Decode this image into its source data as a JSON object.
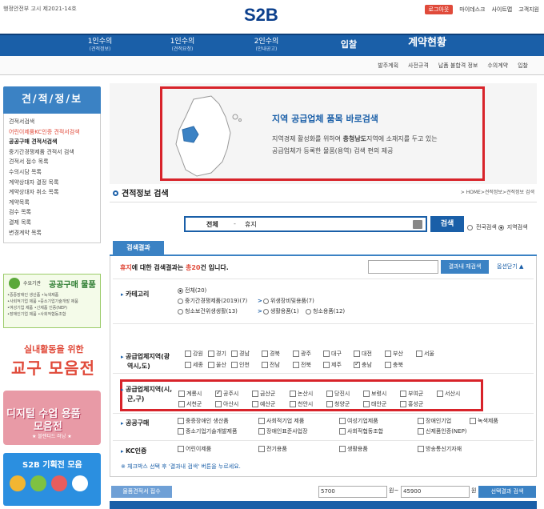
{
  "header": {
    "notice": "행정안전부 고시 제2021-14호",
    "logo": "S2B",
    "login": "로그아웃",
    "links": [
      "마이데스크",
      "사이트맵",
      "고객지원"
    ]
  },
  "nav": {
    "items": [
      {
        "label": "1인수의",
        "sub": "(견적정보)"
      },
      {
        "label": "1인수의",
        "sub": "(견적요청)"
      },
      {
        "label": "2인수의",
        "sub": "(안내공고)"
      }
    ],
    "bid": "입찰",
    "contract": "계약현황",
    "sub_links": [
      "발주계획",
      "사전규격",
      "납품 불합격 정보",
      "수의계약",
      "입찰"
    ]
  },
  "sidebar": {
    "title": "견/적/정/보",
    "items": [
      {
        "label": "견적서검색",
        "style": ""
      },
      {
        "label": "어린이제품KC인증 견적서검색",
        "style": "red"
      },
      {
        "label": "공공구매 견적서검색",
        "style": "bold"
      },
      {
        "label": "중기간경쟁제품 견적서 검색",
        "style": ""
      },
      {
        "label": "견적서 접수 목록",
        "style": ""
      },
      {
        "label": "수의시담 목록",
        "style": ""
      },
      {
        "label": "계약상대자 결정 목록",
        "style": ""
      },
      {
        "label": "계약상대자 취소 목록",
        "style": ""
      },
      {
        "label": "계약목록",
        "style": ""
      },
      {
        "label": "검수 목록",
        "style": ""
      },
      {
        "label": "결제 목록",
        "style": ""
      },
      {
        "label": "변경계약 목록",
        "style": ""
      }
    ],
    "banner1": {
      "small": "수요기관",
      "title": "공공구매 물품",
      "lines": [
        "•중증장애인 생산품 •녹색제품",
        "•사회적기업 제품 •중소기업기술개발 제품",
        "•여성기업 제품 •신제품 인증(NEP)",
        "•장애인기업 제품 •사회적협동조합"
      ]
    },
    "banner2": {
      "line1": "실내활동을 위한",
      "line2": "교구 모음전"
    },
    "banner3": {
      "line1": "디지털 수업 용품",
      "line2": "모음전",
      "sub": "★ 블렌디드 러닝 ★"
    },
    "banner4": {
      "title": "S2B 기획전 모음"
    }
  },
  "promo": {
    "title": "지역 공급업체 품목 바로검색",
    "desc1a": "지역경제 활성화를 위하여 ",
    "desc1b": "충청남도",
    "desc1c": "지역에 소재지를 두고 있는",
    "desc2": "공급업체가 등록한 물품(용역) 검색 편의 제공"
  },
  "section": {
    "title": "견적정보 검색",
    "breadcrumb": "> HOME>견적정보>견적정보 검색"
  },
  "search": {
    "scope": "전체",
    "sep": "-",
    "query": "휴지",
    "button": "검색",
    "opt_all": "전국검색",
    "opt_region": "지역검색"
  },
  "results": {
    "tab": "결과",
    "tab_prefix": "검색",
    "head_q": "휴지",
    "head_mid": "에 대한 검색결과는 ",
    "head_count": "총20",
    "head_end": "건 입니다.",
    "refine_button": "결과내 재검색",
    "option_close": "옵션닫기"
  },
  "filters": {
    "category": {
      "label": "카테고리",
      "row1": [
        {
          "label": "전체(20)",
          "on": true
        }
      ],
      "row2": [
        {
          "label": "중기간경쟁제품(2019)(7)",
          "on": false,
          "arrow": false
        },
        {
          "label": "위생장비및용품(7)",
          "on": false,
          "arrow": true
        }
      ],
      "row3": [
        {
          "label": "청소보건위생생활(13)",
          "on": false,
          "arrow": false
        },
        {
          "label": "생활용품(1)",
          "on": false,
          "arrow": true
        },
        {
          "label": "청소용품(12)",
          "on": false,
          "arrow": false
        }
      ]
    },
    "region1": {
      "label1": "공급업체지역(광",
      "label2": "역시,도)",
      "row1": [
        {
          "label": "강원",
          "on": false
        },
        {
          "label": "경기",
          "on": false
        },
        {
          "label": "경남",
          "on": false
        },
        {
          "label": "경북",
          "on": false
        },
        {
          "label": "광주",
          "on": false
        },
        {
          "label": "대구",
          "on": false
        },
        {
          "label": "대전",
          "on": false
        },
        {
          "label": "부산",
          "on": false
        },
        {
          "label": "서울",
          "on": false
        }
      ],
      "row2": [
        {
          "label": "세종",
          "on": false
        },
        {
          "label": "울산",
          "on": false
        },
        {
          "label": "인천",
          "on": false
        },
        {
          "label": "전남",
          "on": false
        },
        {
          "label": "전북",
          "on": false
        },
        {
          "label": "제주",
          "on": false
        },
        {
          "label": "충남",
          "on": true
        },
        {
          "label": "충북",
          "on": false
        }
      ]
    },
    "region2": {
      "label1": "공급업체지역(시,",
      "label2": "군,구)",
      "row1": [
        {
          "label": "계룡시",
          "on": false
        },
        {
          "label": "공주시",
          "on": true
        },
        {
          "label": "금산군",
          "on": false
        },
        {
          "label": "논산시",
          "on": false
        },
        {
          "label": "당진시",
          "on": false
        },
        {
          "label": "보령시",
          "on": false
        },
        {
          "label": "부여군",
          "on": false
        },
        {
          "label": "서산시",
          "on": false
        }
      ],
      "row2": [
        {
          "label": "서천군",
          "on": false
        },
        {
          "label": "아산시",
          "on": false
        },
        {
          "label": "예산군",
          "on": false
        },
        {
          "label": "천안시",
          "on": false
        },
        {
          "label": "청양군",
          "on": false
        },
        {
          "label": "태안군",
          "on": false
        },
        {
          "label": "홍성군",
          "on": false
        }
      ]
    },
    "public": {
      "label": "공공구매",
      "row1": [
        {
          "label": "중증장애인 생산품",
          "on": false
        },
        {
          "label": "사회적기업 제품",
          "on": false
        },
        {
          "label": "여성기업제품",
          "on": false
        },
        {
          "label": "장애인기업",
          "on": false
        },
        {
          "label": "녹색제품",
          "on": false
        }
      ],
      "row2": [
        {
          "label": "중소기업기술개발제품",
          "on": false
        },
        {
          "label": "장애인표준사업장",
          "on": false
        },
        {
          "label": "사회적협동조합",
          "on": false
        },
        {
          "label": "신제품인증(NEP)",
          "on": false
        }
      ]
    },
    "kc": {
      "label": "KC인증",
      "row1": [
        {
          "label": "어린이제품",
          "on": false
        },
        {
          "label": "전기용품",
          "on": false
        },
        {
          "label": "생활용품",
          "on": false
        },
        {
          "label": "방송통신기자재",
          "on": false
        }
      ]
    },
    "note": "※ 체크박스 선택 후 '결과내 검색' 버튼을 누르세요."
  },
  "bottom": {
    "compare_button": "물품견적서 접수",
    "price_from": "5700",
    "price_sep": "원~",
    "price_to": "45900",
    "unit": "원",
    "range_button": "선택결과 검색"
  },
  "colors": {
    "primary": "#1a5fa8",
    "accent_red": "#d8232a",
    "sidebar_head": "#3b82c4"
  }
}
